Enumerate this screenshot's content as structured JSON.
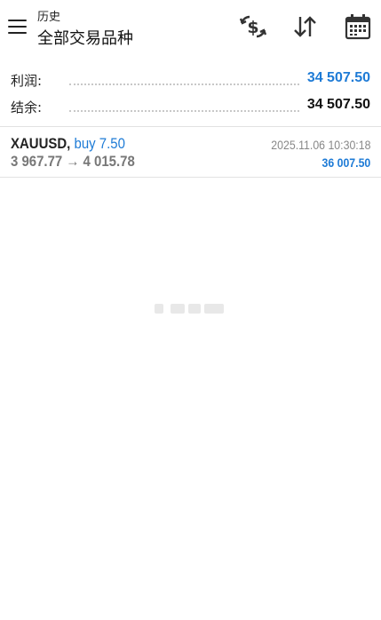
{
  "header": {
    "section": "历史",
    "filter": "全部交易品种",
    "icons": [
      "menu-icon",
      "currency-exchange-icon",
      "sort-icon",
      "calendar-icon"
    ]
  },
  "summary": {
    "profit_label": "利润:",
    "profit_value": "34 507.50",
    "balance_label": "结余:",
    "balance_value": "34 507.50"
  },
  "trades": [
    {
      "symbol": "XAUUSD,",
      "side": "buy 7.50",
      "price_open": "3 967.77",
      "arrow": "→",
      "price_close": "4 015.78",
      "time": "2025.11.06 10:30:18",
      "profit": "36 007.50"
    }
  ],
  "colors": {
    "accent": "#1e7bd6",
    "text": "#222222",
    "muted": "#888888",
    "divider": "#e2e2e2"
  }
}
